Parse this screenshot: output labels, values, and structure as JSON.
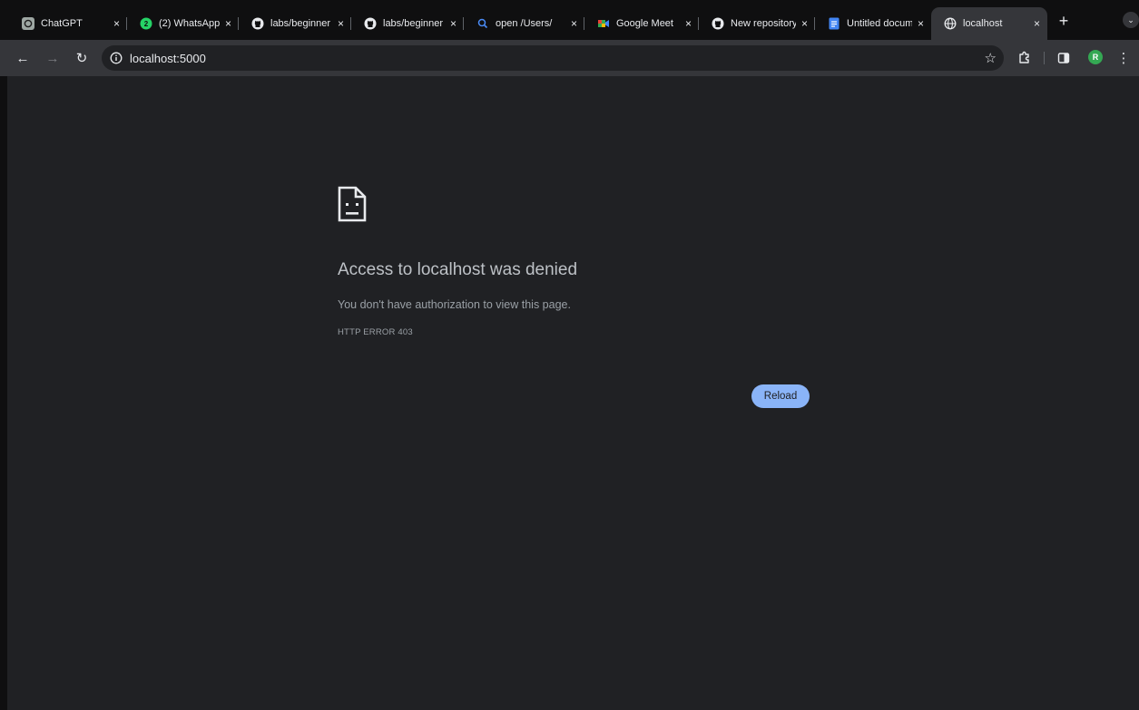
{
  "tabs": [
    {
      "title": "ChatGPT",
      "icon": "chatgpt-icon",
      "close": "×"
    },
    {
      "title": "(2) WhatsApp",
      "icon": "whatsapp-icon",
      "badge": "2",
      "close": "×"
    },
    {
      "title": "labs/beginner",
      "icon": "github-icon",
      "close": "×"
    },
    {
      "title": "labs/beginner",
      "icon": "github-icon",
      "close": "×"
    },
    {
      "title": "open /Users/",
      "icon": "search-icon",
      "close": "×"
    },
    {
      "title": "Google Meet",
      "icon": "google-meet-icon",
      "close": "×"
    },
    {
      "title": "New repository",
      "icon": "github-icon",
      "close": "×"
    },
    {
      "title": "Untitled document",
      "icon": "google-docs-icon",
      "close": "×"
    },
    {
      "title": "localhost",
      "icon": "globe-icon",
      "close": "×",
      "active": true
    }
  ],
  "toolbar": {
    "back": "←",
    "forward": "→",
    "reload": "↻",
    "url": "localhost:5000",
    "bookmark": "☆",
    "new_tab": "+",
    "tab_search": "⌄",
    "menu": "⋮",
    "avatar_initial": "R"
  },
  "error": {
    "heading": "Access to localhost was denied",
    "description": "You don't have authorization to view this page.",
    "code": "HTTP ERROR 403",
    "reload_label": "Reload"
  },
  "colors": {
    "page_bg": "#202124",
    "toolbar_bg": "#35363a",
    "tabstrip_bg": "#0f0f10",
    "accent": "#8ab4f8",
    "avatar": "#34a853"
  }
}
